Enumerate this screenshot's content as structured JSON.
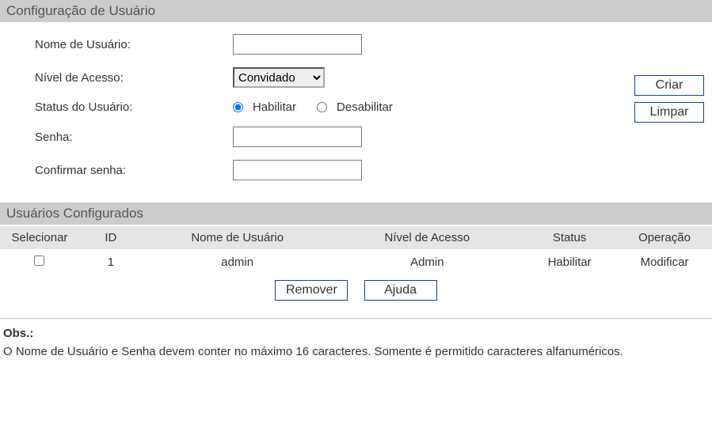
{
  "config": {
    "header": "Configuração de Usuário",
    "labels": {
      "username": "Nome de Usuário:",
      "level": "Nível de Acesso:",
      "status": "Status do Usuário:",
      "password": "Senha:",
      "confirm": "Confirmar senha:"
    },
    "level_options": [
      "Convidado"
    ],
    "level_selected": "Convidado",
    "status_options": {
      "enable": "Habilitar",
      "disable": "Desabilitar"
    },
    "buttons": {
      "create": "Criar",
      "clear": "Limpar"
    }
  },
  "users": {
    "header": "Usuários Configurados",
    "columns": {
      "select": "Selecionar",
      "id": "ID",
      "username": "Nome de Usuário",
      "level": "Nível de Acesso",
      "status": "Status",
      "op": "Operação"
    },
    "rows": [
      {
        "id": "1",
        "username": "admin",
        "level": "Admin",
        "status": "Habilitar",
        "op": "Modificar"
      }
    ],
    "buttons": {
      "remove": "Remover",
      "help": "Ajuda"
    }
  },
  "note": {
    "title": "Obs.:",
    "text": "O Nome de Usuário e Senha devem conter no máximo 16 caracteres. Somente é permitido caracteres alfanuméricos."
  }
}
